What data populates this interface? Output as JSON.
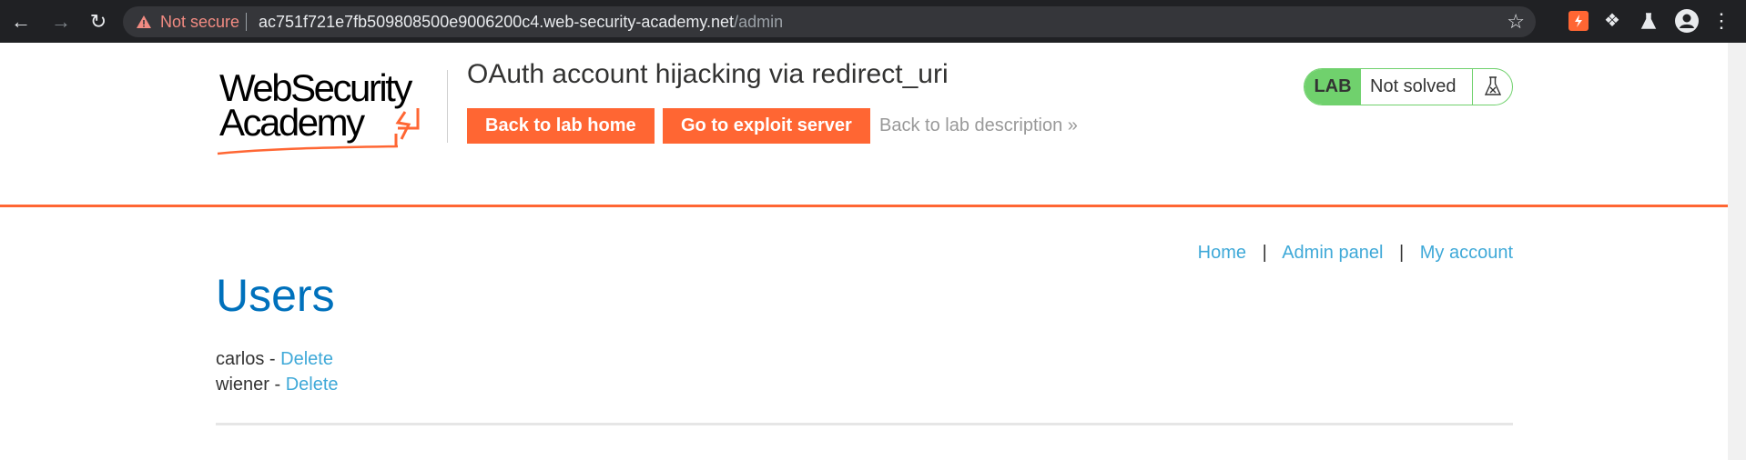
{
  "browser": {
    "security_label": "Not secure",
    "url_host": "ac751f721e7fb509808500e9006200c4.web-security-academy.net",
    "url_path": "/admin",
    "icons": [
      "back-icon",
      "forward-icon",
      "reload-icon",
      "warning-icon",
      "star-icon",
      "burp-extension-icon",
      "extensions-icon",
      "labs-icon",
      "profile-icon",
      "menu-icon"
    ]
  },
  "header": {
    "logo_line1": "WebSecurity",
    "logo_line2": "Academy",
    "lab_title": "OAuth account hijacking via redirect_uri",
    "back_home_label": "Back to lab home",
    "exploit_label": "Go to exploit server",
    "description_label": "Back to lab description",
    "description_chevron": "»",
    "status_tag": "LAB",
    "status_text": "Not solved"
  },
  "nav": {
    "home": "Home",
    "separator": "|",
    "admin": "Admin panel",
    "account": "My account"
  },
  "main": {
    "title": "Users",
    "users": [
      {
        "name": "carlos",
        "dash": " - ",
        "action": "Delete"
      },
      {
        "name": "wiener",
        "dash": " - ",
        "action": "Delete"
      }
    ]
  },
  "colors": {
    "accent": "#ff6633",
    "heading": "#0071bc",
    "link": "#3fa9d8",
    "status_green": "#70d16d",
    "chrome_bg": "#202124"
  }
}
